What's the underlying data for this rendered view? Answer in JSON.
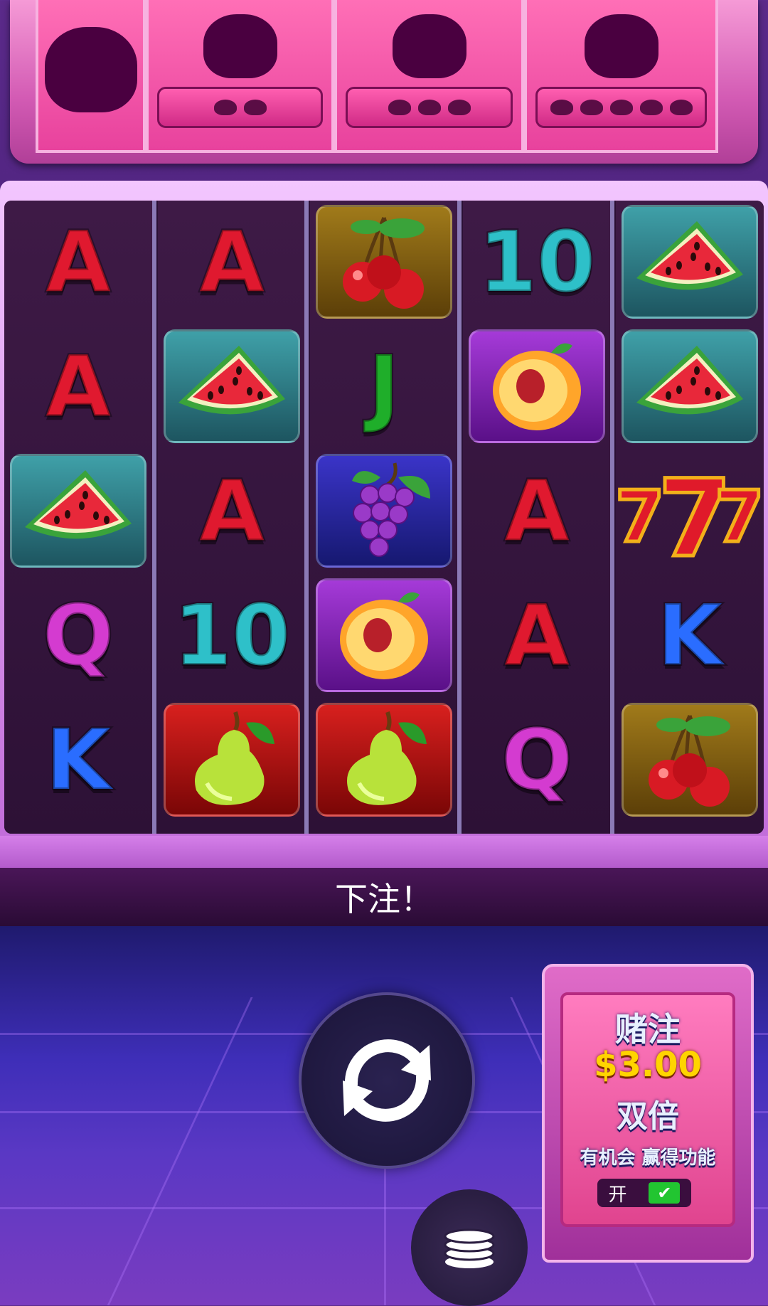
{
  "jackpots": [
    {
      "id": "jackpot-1",
      "pips": 0
    },
    {
      "id": "jackpot-2",
      "pips": 2
    },
    {
      "id": "jackpot-3",
      "pips": 3
    },
    {
      "id": "jackpot-4",
      "pips": 5
    }
  ],
  "grid": [
    [
      {
        "sym": "A",
        "tile": "none"
      },
      {
        "sym": "A",
        "tile": "none"
      },
      {
        "sym": "watermelon-icon",
        "tile": "teal"
      },
      {
        "sym": "Q",
        "tile": "none"
      },
      {
        "sym": "K",
        "tile": "none"
      }
    ],
    [
      {
        "sym": "A",
        "tile": "none"
      },
      {
        "sym": "watermelon-icon",
        "tile": "teal"
      },
      {
        "sym": "A",
        "tile": "none"
      },
      {
        "sym": "10",
        "tile": "none"
      },
      {
        "sym": "pear-icon",
        "tile": "red"
      }
    ],
    [
      {
        "sym": "cherry-icon",
        "tile": "gold"
      },
      {
        "sym": "J",
        "tile": "none"
      },
      {
        "sym": "grapes-icon",
        "tile": "blue"
      },
      {
        "sym": "peach-icon",
        "tile": "purple"
      },
      {
        "sym": "pear-icon",
        "tile": "red"
      }
    ],
    [
      {
        "sym": "10",
        "tile": "none"
      },
      {
        "sym": "peach-icon",
        "tile": "purple"
      },
      {
        "sym": "A",
        "tile": "none"
      },
      {
        "sym": "A",
        "tile": "none"
      },
      {
        "sym": "Q",
        "tile": "none"
      }
    ],
    [
      {
        "sym": "watermelon-icon",
        "tile": "teal"
      },
      {
        "sym": "watermelon-icon",
        "tile": "teal"
      },
      {
        "sym": "seven-icon",
        "tile": "none"
      },
      {
        "sym": "K",
        "tile": "none"
      },
      {
        "sym": "cherry-icon",
        "tile": "gold"
      }
    ]
  ],
  "message": "下注！",
  "ante": {
    "title": "赌注",
    "amount": "$3.00",
    "double": "双倍",
    "chance": "有机会 赢得功能",
    "toggle_label": "开",
    "toggle_on": true
  },
  "colors": {
    "accent": "#e8429d",
    "panel": "#ff7cbf",
    "check": "#22c531"
  }
}
